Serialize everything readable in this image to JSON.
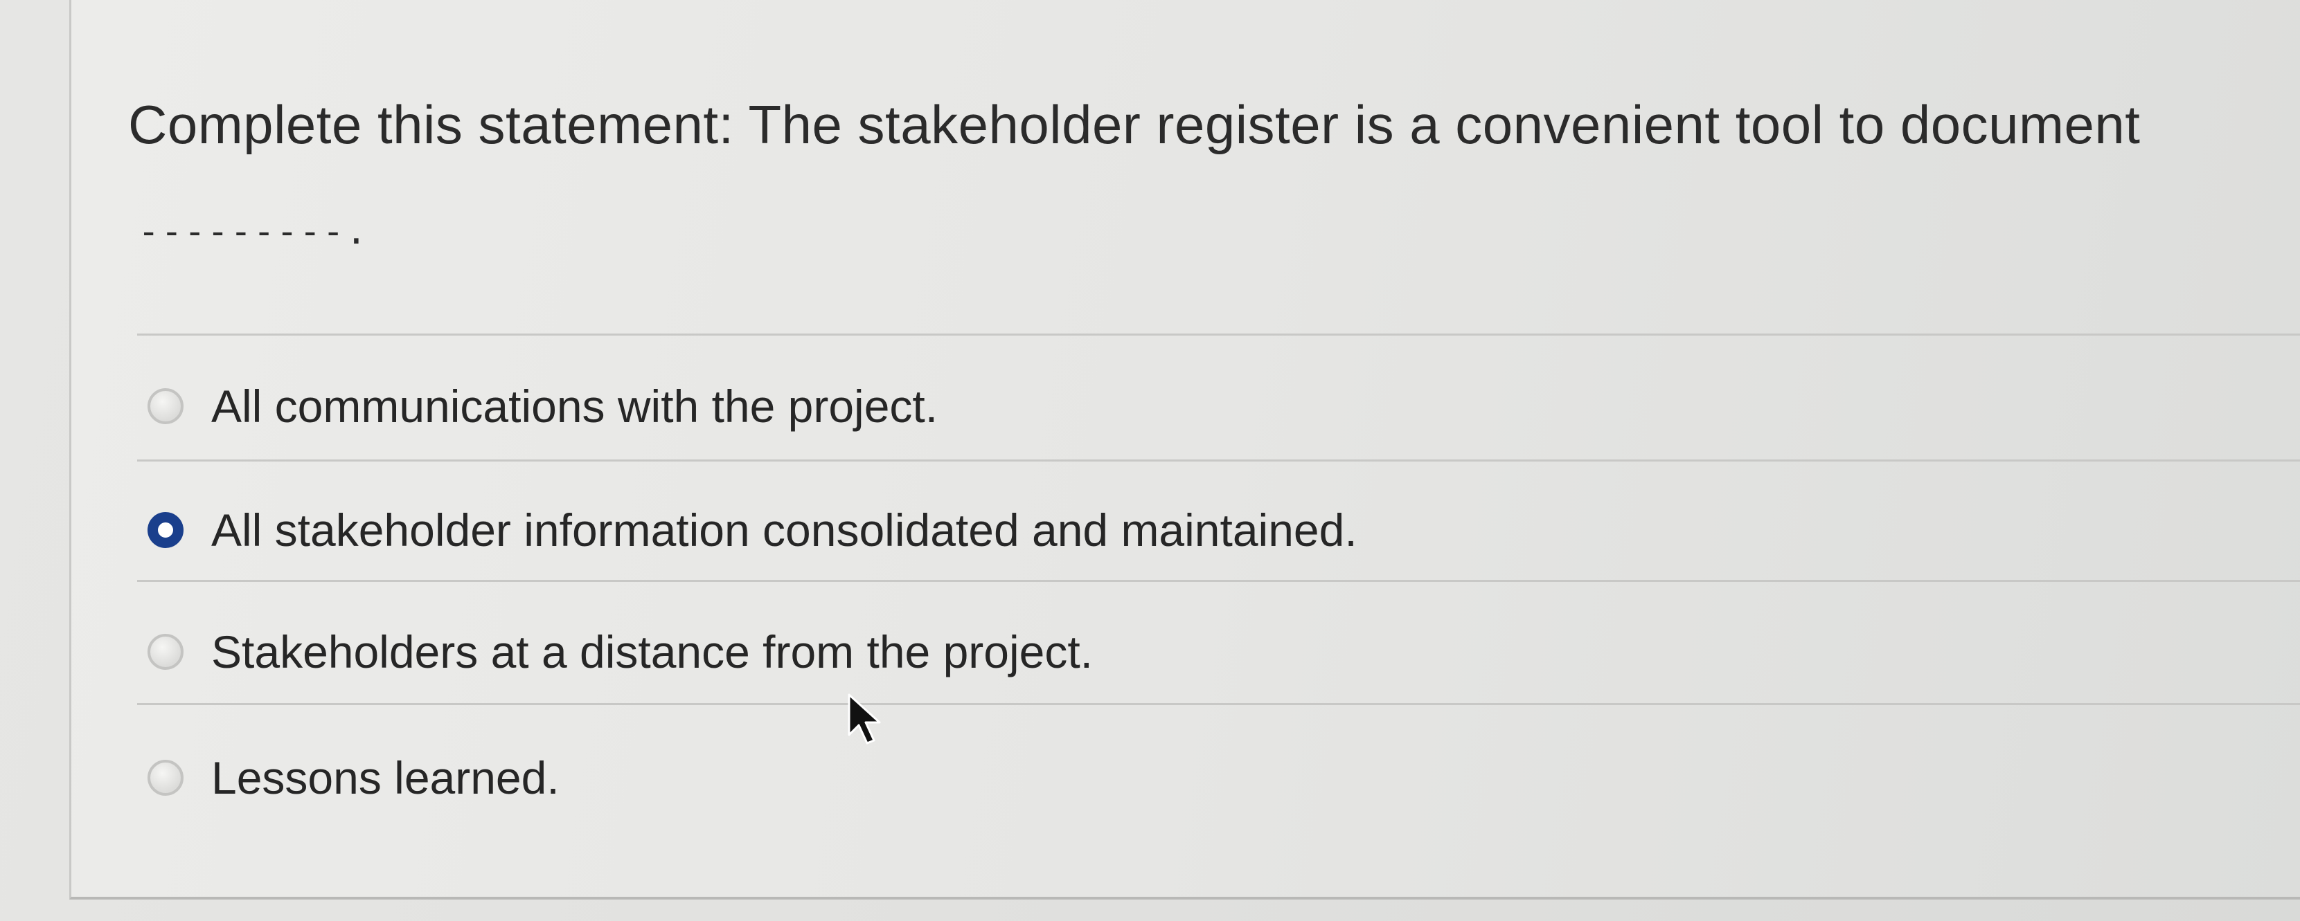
{
  "question": {
    "text": "Complete this statement: The stakeholder register is a convenient tool to document",
    "blank": "---------."
  },
  "options": [
    {
      "label": "All communications with the project.",
      "selected": false
    },
    {
      "label": "All stakeholder information consolidated and maintained.",
      "selected": true
    },
    {
      "label": "Stakeholders at a distance from the project.",
      "selected": false
    },
    {
      "label": "Lessons learned.",
      "selected": false
    }
  ],
  "colors": {
    "selected_radio": "#1a3f8c",
    "text": "#262626"
  },
  "icons": {
    "cursor": "mouse-pointer-icon"
  }
}
